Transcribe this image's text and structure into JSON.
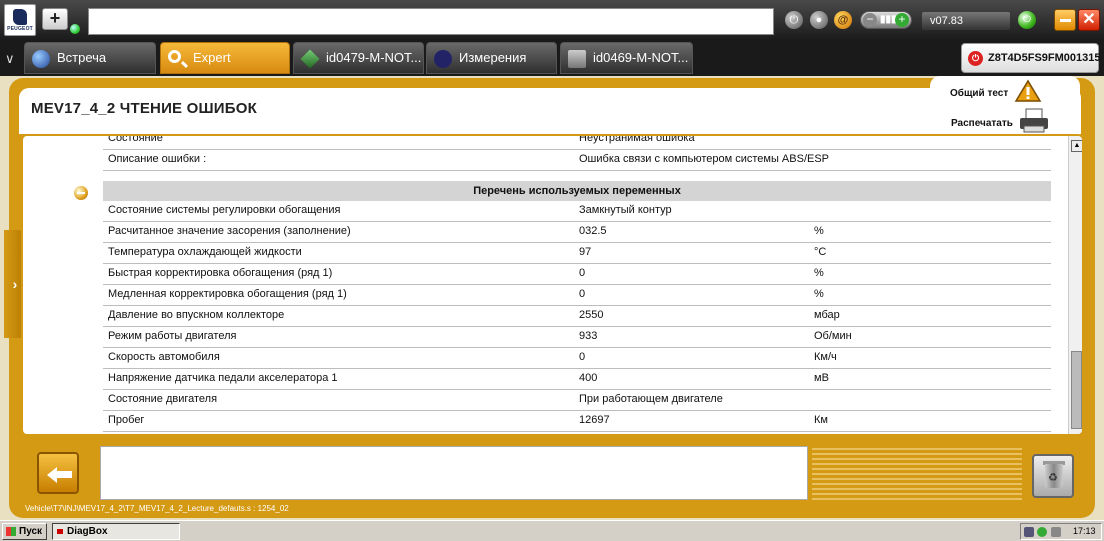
{
  "topbar": {
    "logo_text": "PEUGEOT",
    "version": "v07.83"
  },
  "tabs": [
    {
      "label": "Встреча"
    },
    {
      "label": "Expert"
    },
    {
      "label": "id0479-M-NOT..."
    },
    {
      "label": "Измерения"
    },
    {
      "label": "id0469-M-NOT..."
    }
  ],
  "vin": "Z8T4D5FS9FM001315",
  "page": {
    "title": "MEV17_4_2  ЧТЕНИЕ ОШИБОК",
    "general_test_label": "Общий тест",
    "print_label": "Распечатать"
  },
  "fault_rows": [
    {
      "name": "Состояние",
      "value": "Неустранимая ошибка",
      "unit": ""
    },
    {
      "name": "Описание ошибки :",
      "value": "Ошибка связи с компьютером системы ABS/ESP",
      "unit": ""
    }
  ],
  "section_title": "Перечень используемых переменных",
  "variables": [
    {
      "name": "Состояние системы регулировки обогащения",
      "value": "Замкнутый контур",
      "unit": ""
    },
    {
      "name": "Расчитанное значение засорения (заполнение)",
      "value": "032.5",
      "unit": "%"
    },
    {
      "name": "Температура охлаждающей жидкости",
      "value": "97",
      "unit": "°C"
    },
    {
      "name": "Быстрая корректировка обогащения (ряд 1)",
      "value": "0",
      "unit": "%"
    },
    {
      "name": "Медленная корректировка обогащения (ряд 1)",
      "value": "0",
      "unit": "%"
    },
    {
      "name": "Давление во впускном коллекторе",
      "value": "2550",
      "unit": "мбар"
    },
    {
      "name": "Режим работы двигателя",
      "value": "933",
      "unit": "Об/мин"
    },
    {
      "name": "Скорость автомобиля",
      "value": "0",
      "unit": "Км/ч"
    },
    {
      "name": "Напряжение датчика педали акселератора 1",
      "value": "400",
      "unit": "мВ"
    },
    {
      "name": "Состояние двигателя",
      "value": "При работающем двигателе",
      "unit": ""
    },
    {
      "name": "Пробег",
      "value": "12697",
      "unit": "Км"
    }
  ],
  "status_path": "Vehicle\\T7\\INJ\\MEV17_4_2\\T7_MEV17_4_2_Lecture_defauts.s : 1254_02",
  "taskbar": {
    "start_label": "Пуск",
    "app_label": "DiagBox",
    "clock": "17:13"
  }
}
